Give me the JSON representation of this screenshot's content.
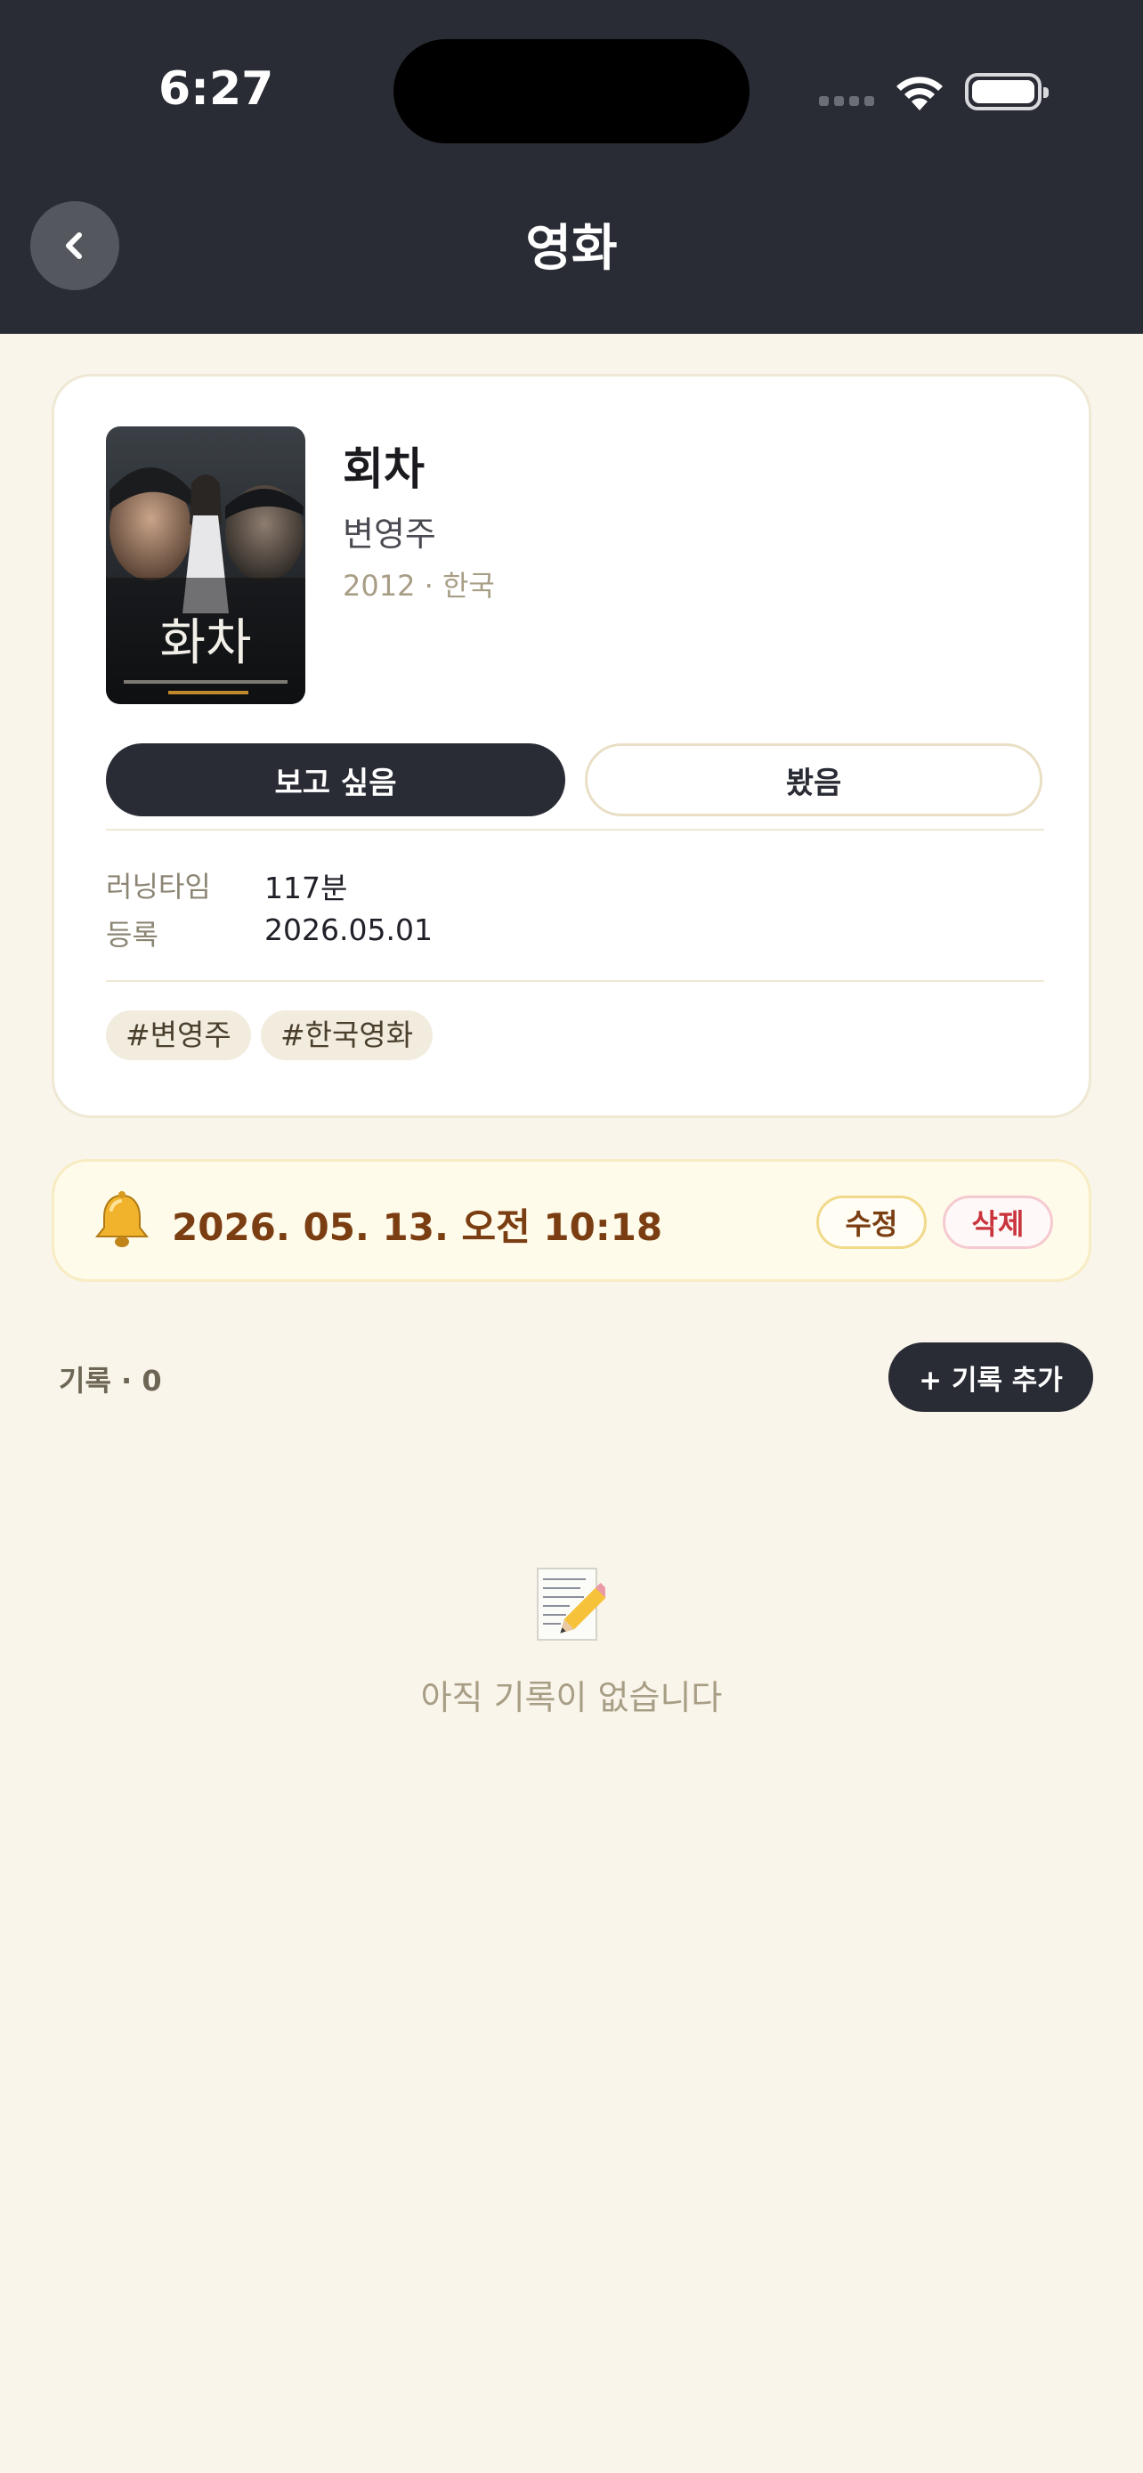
{
  "status_bar": {
    "time": "6:27"
  },
  "header": {
    "title": "영화"
  },
  "movie": {
    "title": "회차",
    "director": "변영주",
    "meta": "2012 · 한국",
    "poster_title": "화차",
    "buttons": {
      "want": "보고 싶음",
      "watched": "봤음"
    },
    "info": [
      {
        "label": "러닝타임",
        "value": "117분"
      },
      {
        "label": "등록",
        "value": "2026.05.01"
      }
    ],
    "tags": [
      "#변영주",
      "#한국영화"
    ]
  },
  "reminder": {
    "datetime": "2026. 05. 13. 오전 10:18",
    "edit_label": "수정",
    "delete_label": "삭제"
  },
  "records": {
    "count_label": "기록 · 0",
    "add_label": "+ 기록 추가",
    "empty_text": "아직 기록이 없습니다"
  },
  "colors": {
    "header_bg": "#2a2c35",
    "page_bg": "#faf5ea",
    "reminder_text": "#7a3e12",
    "delete_red": "#c9343c"
  }
}
